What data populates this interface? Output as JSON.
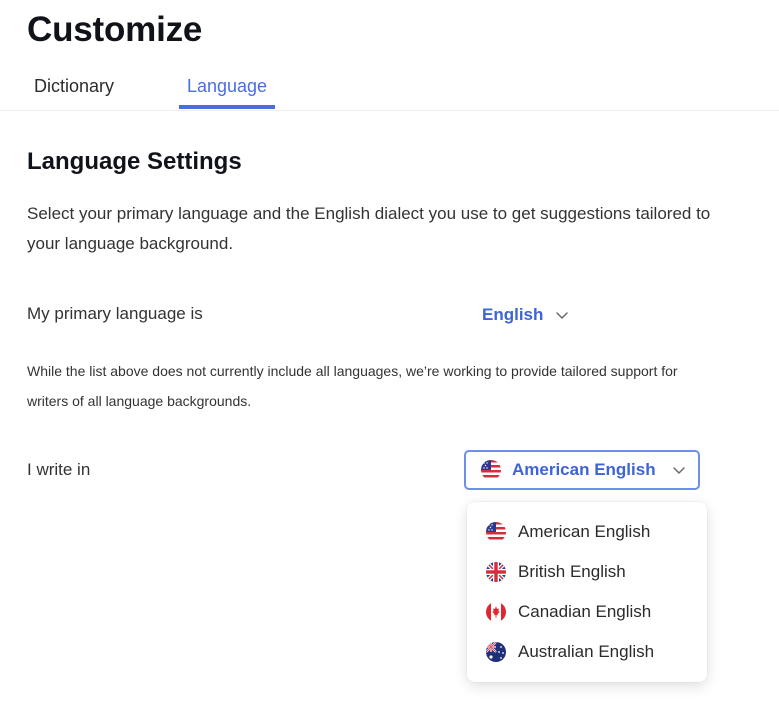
{
  "page": {
    "title": "Customize"
  },
  "tabs": [
    {
      "label": "Dictionary",
      "active": false
    },
    {
      "label": "Language",
      "active": true
    }
  ],
  "language_settings": {
    "title": "Language Settings",
    "description": "Select your primary language and the English dialect you use to get suggestions tailored to your language background.",
    "primary_language_label": "My primary language is",
    "primary_language_value": "English",
    "note": "While the list above does not currently include all languages, we’re working to provide tailored support for writers of all language backgrounds.",
    "dialect_label": "I write in",
    "dialect_value": "American English",
    "dialect_flag": "us-flag-icon"
  },
  "dialect_options": [
    {
      "label": "American English",
      "icon": "us-flag-icon"
    },
    {
      "label": "British English",
      "icon": "uk-flag-icon"
    },
    {
      "label": "Canadian English",
      "icon": "canada-flag-icon"
    },
    {
      "label": "Australian English",
      "icon": "australia-flag-icon"
    }
  ],
  "colors": {
    "accent": "#4a6ee0",
    "selected_text": "#3d64d8",
    "select_border": "#6f8fe6"
  }
}
